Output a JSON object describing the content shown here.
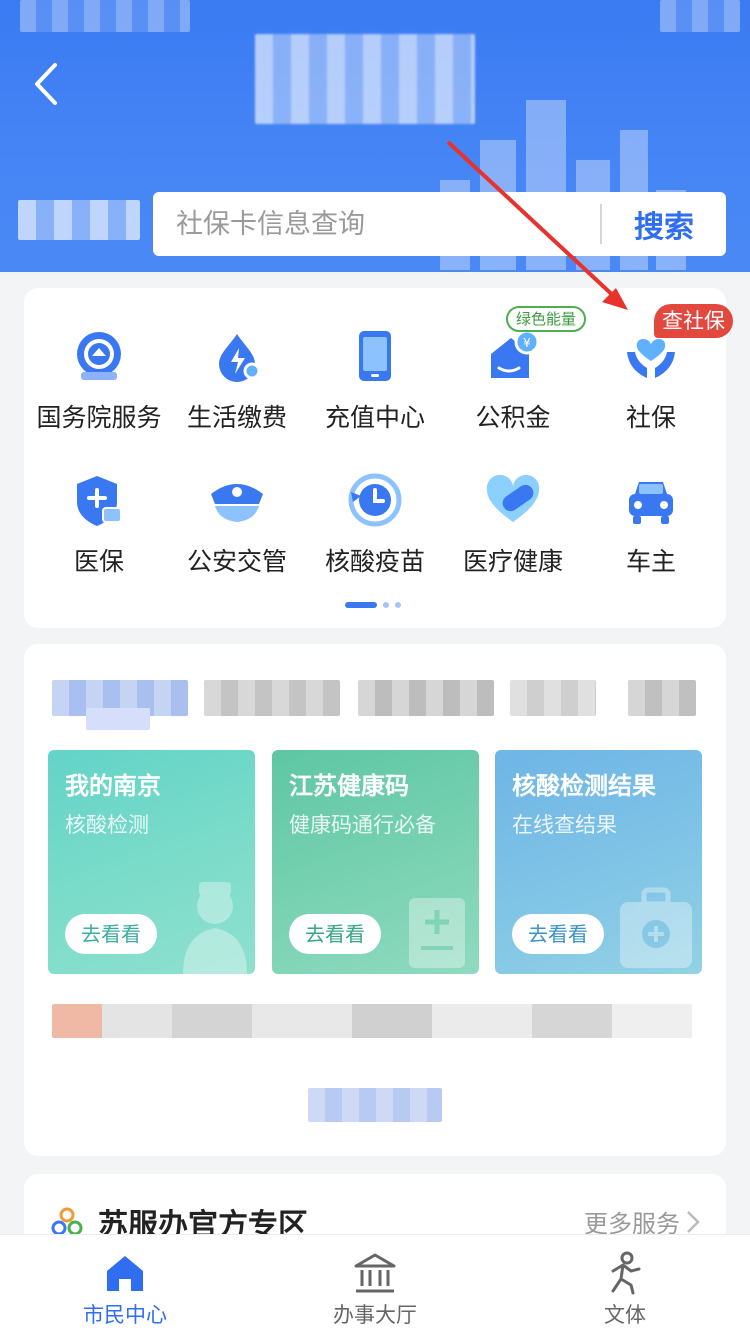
{
  "header": {
    "back_icon": "chevron-left-icon",
    "search": {
      "placeholder": "社保卡信息查询",
      "button_label": "搜索"
    }
  },
  "services": {
    "items": [
      {
        "label": "国务院服务",
        "icon": "state-council-icon"
      },
      {
        "label": "生活缴费",
        "icon": "utility-bill-icon"
      },
      {
        "label": "充值中心",
        "icon": "phone-recharge-icon"
      },
      {
        "label": "公积金",
        "icon": "housing-fund-icon",
        "badge": "绿色能量"
      },
      {
        "label": "社保",
        "icon": "social-security-icon",
        "badge": "查社保"
      },
      {
        "label": "医保",
        "icon": "medical-insurance-icon"
      },
      {
        "label": "公安交管",
        "icon": "police-cap-icon"
      },
      {
        "label": "核酸疫苗",
        "icon": "vaccine-clock-icon"
      },
      {
        "label": "医疗健康",
        "icon": "health-pill-icon"
      },
      {
        "label": "车主",
        "icon": "car-icon"
      }
    ],
    "pager": {
      "pages": 3,
      "active": 1
    }
  },
  "features": {
    "cards": [
      {
        "title": "我的南京",
        "subtitle": "核酸检测",
        "action": "去看看",
        "color": "#63d3c8"
      },
      {
        "title": "江苏健康码",
        "subtitle": "健康码通行必备",
        "action": "去看看",
        "color": "#5ec6a4"
      },
      {
        "title": "核酸检测结果",
        "subtitle": "在线查结果",
        "action": "去看看",
        "color": "#6fb5e6"
      }
    ]
  },
  "zone": {
    "title": "苏服办官方专区",
    "more_label": "更多服务"
  },
  "tabbar": {
    "tabs": [
      {
        "label": "市民中心",
        "icon": "home-icon",
        "active": true
      },
      {
        "label": "办事大厅",
        "icon": "government-hall-icon",
        "active": false
      },
      {
        "label": "文体",
        "icon": "sports-runner-icon",
        "active": false
      }
    ]
  },
  "colors": {
    "primary": "#2f6ef0",
    "header": "#3b7bf2",
    "badge_red": "#e2483d",
    "badge_green": "#4caf50"
  }
}
